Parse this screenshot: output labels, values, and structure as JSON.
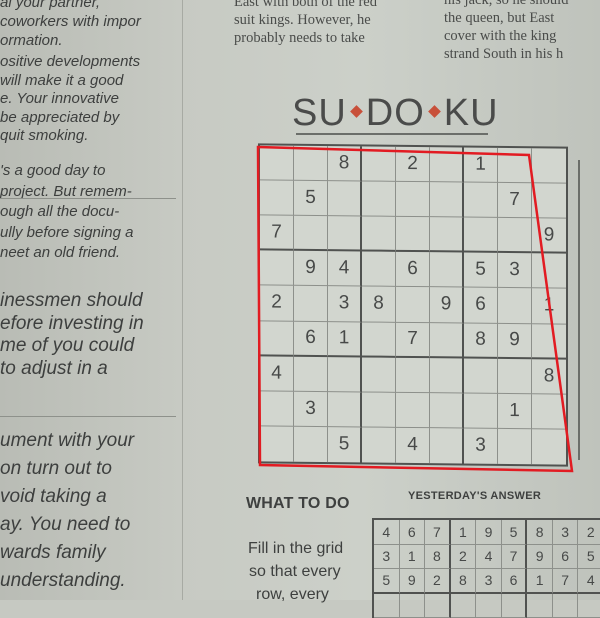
{
  "left_column": {
    "lines_top": [
      "al your partner,",
      "coworkers with impor",
      "ormation."
    ],
    "lines_mid": [
      "ositive developments",
      "will make it a good",
      "e. Your innovative",
      "be appreciated by",
      "quit smoking."
    ],
    "lines_mid2": [
      "'s a good day to",
      "project. But remem-",
      "ough all the docu-",
      "ully before signing a",
      "neet an old friend."
    ],
    "lines_mid3": [
      "inessmen should",
      "efore investing in",
      "me of you could",
      "to adjust in a"
    ],
    "lines_bottom": [
      "ument with your",
      "on turn out to",
      "void taking a",
      "ay. You need to",
      "wards family",
      "understanding."
    ]
  },
  "top_columns": {
    "col1": [
      "East with both of the red",
      "suit kings. However, he",
      "probably needs to take"
    ],
    "col2": [
      "his jack, so he should",
      "the queen, but East",
      "cover with the king",
      "strand South in his h"
    ]
  },
  "title": {
    "p1": "SU",
    "p2": "DO",
    "p3": "KU"
  },
  "puzzle": {
    "rows": [
      [
        "",
        "",
        "8",
        "",
        "2",
        "",
        "1",
        "",
        ""
      ],
      [
        "",
        "5",
        "",
        "",
        "",
        "",
        "",
        "7",
        ""
      ],
      [
        "7",
        "",
        "",
        "",
        "",
        "",
        "",
        "",
        "9"
      ],
      [
        "",
        "9",
        "4",
        "",
        "6",
        "",
        "5",
        "3",
        ""
      ],
      [
        "2",
        "",
        "3",
        "8",
        "",
        "9",
        "6",
        "",
        "1"
      ],
      [
        "",
        "6",
        "1",
        "",
        "7",
        "",
        "8",
        "9",
        ""
      ],
      [
        "4",
        "",
        "",
        "",
        "",
        "",
        "",
        "",
        "8"
      ],
      [
        "",
        "3",
        "",
        "",
        "",
        "",
        "",
        "1",
        ""
      ],
      [
        "",
        "",
        "5",
        "",
        "4",
        "",
        "3",
        "",
        ""
      ]
    ]
  },
  "what_to_do": {
    "heading": "WHAT TO DO",
    "lines": [
      "Fill in the grid",
      "so that every",
      "row, every"
    ]
  },
  "yesterdays_answer": {
    "heading": "YESTERDAY'S ANSWER",
    "rows": [
      [
        "4",
        "6",
        "7",
        "1",
        "9",
        "5",
        "8",
        "3",
        "2"
      ],
      [
        "3",
        "1",
        "8",
        "2",
        "4",
        "7",
        "9",
        "6",
        "5"
      ],
      [
        "5",
        "9",
        "2",
        "8",
        "3",
        "6",
        "1",
        "7",
        "4"
      ],
      [
        "",
        "",
        "",
        "",
        "",
        "",
        "",
        "",
        ""
      ]
    ]
  },
  "colors": {
    "highlight": "#e21b22",
    "diamond": "#c8503a"
  }
}
